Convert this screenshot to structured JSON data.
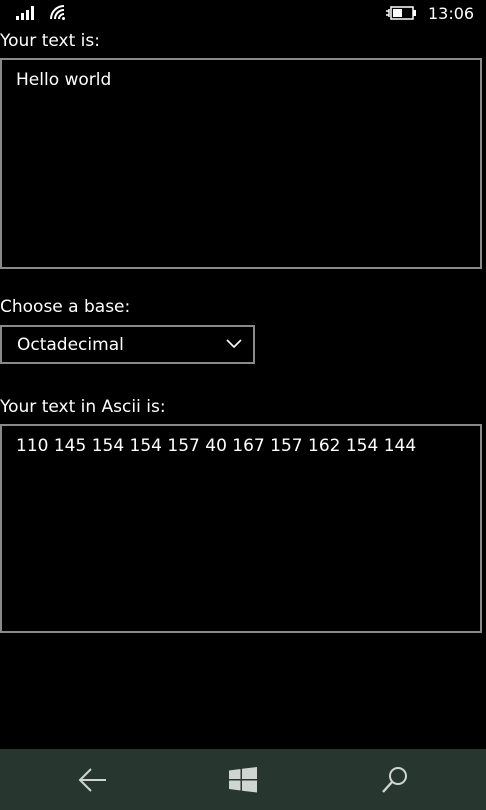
{
  "status_bar": {
    "time": "13:06",
    "icons": [
      "signal-icon",
      "wifi-icon",
      "battery-charging-icon"
    ]
  },
  "input": {
    "label": "Your text is:",
    "value": "Hello world"
  },
  "base": {
    "label": "Choose a base:",
    "selected": "Octadecimal"
  },
  "output": {
    "label": "Your text in Ascii is:",
    "value": "110 145 154 154 157 40 167 157 162 154 144"
  },
  "nav_bar": {
    "icons": [
      "back-arrow-icon",
      "windows-start-icon",
      "search-icon"
    ]
  },
  "colors": {
    "background": "#000000",
    "text": "#ffffff",
    "border": "#8a8a8a",
    "nav_bar": "#27372f"
  }
}
